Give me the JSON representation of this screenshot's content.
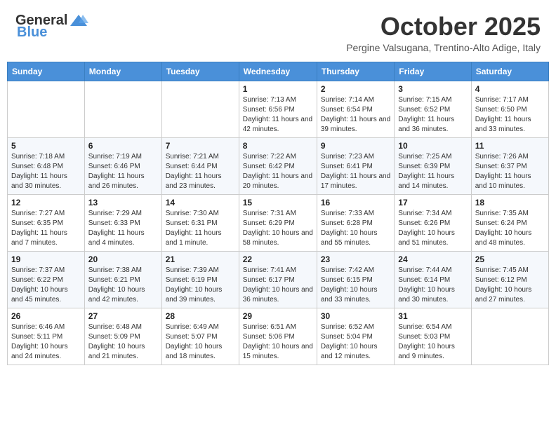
{
  "header": {
    "logo_general": "General",
    "logo_blue": "Blue",
    "month_title": "October 2025",
    "location": "Pergine Valsugana, Trentino-Alto Adige, Italy"
  },
  "days_of_week": [
    "Sunday",
    "Monday",
    "Tuesday",
    "Wednesday",
    "Thursday",
    "Friday",
    "Saturday"
  ],
  "weeks": [
    [
      {
        "day": "",
        "info": ""
      },
      {
        "day": "",
        "info": ""
      },
      {
        "day": "",
        "info": ""
      },
      {
        "day": "1",
        "info": "Sunrise: 7:13 AM\nSunset: 6:56 PM\nDaylight: 11 hours and 42 minutes."
      },
      {
        "day": "2",
        "info": "Sunrise: 7:14 AM\nSunset: 6:54 PM\nDaylight: 11 hours and 39 minutes."
      },
      {
        "day": "3",
        "info": "Sunrise: 7:15 AM\nSunset: 6:52 PM\nDaylight: 11 hours and 36 minutes."
      },
      {
        "day": "4",
        "info": "Sunrise: 7:17 AM\nSunset: 6:50 PM\nDaylight: 11 hours and 33 minutes."
      }
    ],
    [
      {
        "day": "5",
        "info": "Sunrise: 7:18 AM\nSunset: 6:48 PM\nDaylight: 11 hours and 30 minutes."
      },
      {
        "day": "6",
        "info": "Sunrise: 7:19 AM\nSunset: 6:46 PM\nDaylight: 11 hours and 26 minutes."
      },
      {
        "day": "7",
        "info": "Sunrise: 7:21 AM\nSunset: 6:44 PM\nDaylight: 11 hours and 23 minutes."
      },
      {
        "day": "8",
        "info": "Sunrise: 7:22 AM\nSunset: 6:42 PM\nDaylight: 11 hours and 20 minutes."
      },
      {
        "day": "9",
        "info": "Sunrise: 7:23 AM\nSunset: 6:41 PM\nDaylight: 11 hours and 17 minutes."
      },
      {
        "day": "10",
        "info": "Sunrise: 7:25 AM\nSunset: 6:39 PM\nDaylight: 11 hours and 14 minutes."
      },
      {
        "day": "11",
        "info": "Sunrise: 7:26 AM\nSunset: 6:37 PM\nDaylight: 11 hours and 10 minutes."
      }
    ],
    [
      {
        "day": "12",
        "info": "Sunrise: 7:27 AM\nSunset: 6:35 PM\nDaylight: 11 hours and 7 minutes."
      },
      {
        "day": "13",
        "info": "Sunrise: 7:29 AM\nSunset: 6:33 PM\nDaylight: 11 hours and 4 minutes."
      },
      {
        "day": "14",
        "info": "Sunrise: 7:30 AM\nSunset: 6:31 PM\nDaylight: 11 hours and 1 minute."
      },
      {
        "day": "15",
        "info": "Sunrise: 7:31 AM\nSunset: 6:29 PM\nDaylight: 10 hours and 58 minutes."
      },
      {
        "day": "16",
        "info": "Sunrise: 7:33 AM\nSunset: 6:28 PM\nDaylight: 10 hours and 55 minutes."
      },
      {
        "day": "17",
        "info": "Sunrise: 7:34 AM\nSunset: 6:26 PM\nDaylight: 10 hours and 51 minutes."
      },
      {
        "day": "18",
        "info": "Sunrise: 7:35 AM\nSunset: 6:24 PM\nDaylight: 10 hours and 48 minutes."
      }
    ],
    [
      {
        "day": "19",
        "info": "Sunrise: 7:37 AM\nSunset: 6:22 PM\nDaylight: 10 hours and 45 minutes."
      },
      {
        "day": "20",
        "info": "Sunrise: 7:38 AM\nSunset: 6:21 PM\nDaylight: 10 hours and 42 minutes."
      },
      {
        "day": "21",
        "info": "Sunrise: 7:39 AM\nSunset: 6:19 PM\nDaylight: 10 hours and 39 minutes."
      },
      {
        "day": "22",
        "info": "Sunrise: 7:41 AM\nSunset: 6:17 PM\nDaylight: 10 hours and 36 minutes."
      },
      {
        "day": "23",
        "info": "Sunrise: 7:42 AM\nSunset: 6:15 PM\nDaylight: 10 hours and 33 minutes."
      },
      {
        "day": "24",
        "info": "Sunrise: 7:44 AM\nSunset: 6:14 PM\nDaylight: 10 hours and 30 minutes."
      },
      {
        "day": "25",
        "info": "Sunrise: 7:45 AM\nSunset: 6:12 PM\nDaylight: 10 hours and 27 minutes."
      }
    ],
    [
      {
        "day": "26",
        "info": "Sunrise: 6:46 AM\nSunset: 5:11 PM\nDaylight: 10 hours and 24 minutes."
      },
      {
        "day": "27",
        "info": "Sunrise: 6:48 AM\nSunset: 5:09 PM\nDaylight: 10 hours and 21 minutes."
      },
      {
        "day": "28",
        "info": "Sunrise: 6:49 AM\nSunset: 5:07 PM\nDaylight: 10 hours and 18 minutes."
      },
      {
        "day": "29",
        "info": "Sunrise: 6:51 AM\nSunset: 5:06 PM\nDaylight: 10 hours and 15 minutes."
      },
      {
        "day": "30",
        "info": "Sunrise: 6:52 AM\nSunset: 5:04 PM\nDaylight: 10 hours and 12 minutes."
      },
      {
        "day": "31",
        "info": "Sunrise: 6:54 AM\nSunset: 5:03 PM\nDaylight: 10 hours and 9 minutes."
      },
      {
        "day": "",
        "info": ""
      }
    ]
  ]
}
